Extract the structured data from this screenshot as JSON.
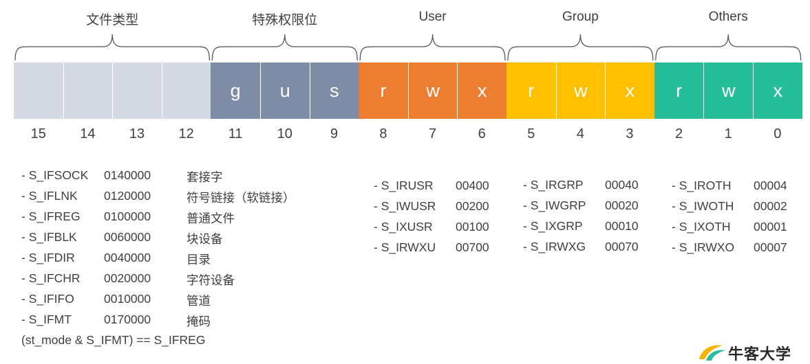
{
  "groups": [
    {
      "label": "文件类型",
      "color": "#d5d9e3",
      "bits": [
        "",
        "",
        "",
        ""
      ]
    },
    {
      "label": "特殊权限位",
      "color": "#7f8ca6",
      "bits": [
        "g",
        "u",
        "s"
      ]
    },
    {
      "label": "User",
      "color": "#ed7d31",
      "bits": [
        "r",
        "w",
        "x"
      ]
    },
    {
      "label": "Group",
      "color": "#ffc000",
      "bits": [
        "r",
        "w",
        "x"
      ]
    },
    {
      "label": "Others",
      "color": "#26bd99",
      "bits": [
        "r",
        "w",
        "x"
      ]
    }
  ],
  "bit_numbers": [
    "15",
    "14",
    "13",
    "12",
    "11",
    "10",
    "9",
    "8",
    "7",
    "6",
    "5",
    "4",
    "3",
    "2",
    "1",
    "0"
  ],
  "file_types": [
    {
      "name": "- S_IFSOCK",
      "value": "0140000",
      "desc": "套接字"
    },
    {
      "name": "- S_IFLNK",
      "value": "0120000",
      "desc": "符号链接（软链接）"
    },
    {
      "name": "- S_IFREG",
      "value": "0100000",
      "desc": "普通文件"
    },
    {
      "name": "- S_IFBLK",
      "value": "0060000",
      "desc": "块设备"
    },
    {
      "name": "- S_IFDIR",
      "value": "0040000",
      "desc": "目录"
    },
    {
      "name": "- S_IFCHR",
      "value": "0020000",
      "desc": "字符设备"
    },
    {
      "name": "- S_IFIFO",
      "value": "0010000",
      "desc": "管道"
    },
    {
      "name": "- S_IFMT",
      "value": "0170000",
      "desc": "掩码"
    }
  ],
  "mode_expr": "(st_mode & S_IFMT) ==  S_IFREG",
  "user_perms": [
    {
      "name": "- S_IRUSR",
      "value": "00400"
    },
    {
      "name": "- S_IWUSR",
      "value": "00200"
    },
    {
      "name": "- S_IXUSR",
      "value": "00100"
    },
    {
      "name": "- S_IRWXU",
      "value": "00700"
    }
  ],
  "group_perms": [
    {
      "name": "- S_IRGRP",
      "value": "00040"
    },
    {
      "name": "- S_IWGRP",
      "value": "00020"
    },
    {
      "name": "- S_IXGRP",
      "value": "00010"
    },
    {
      "name": "- S_IRWXG",
      "value": "00070"
    }
  ],
  "other_perms": [
    {
      "name": "- S_IROTH",
      "value": "00004"
    },
    {
      "name": "- S_IWOTH",
      "value": "00002"
    },
    {
      "name": "- S_IXOTH",
      "value": "00001"
    },
    {
      "name": "- S_IRWXO",
      "value": "00007"
    }
  ],
  "logo": {
    "text": "牛客大学",
    "icon": "leaf-logo-icon"
  }
}
